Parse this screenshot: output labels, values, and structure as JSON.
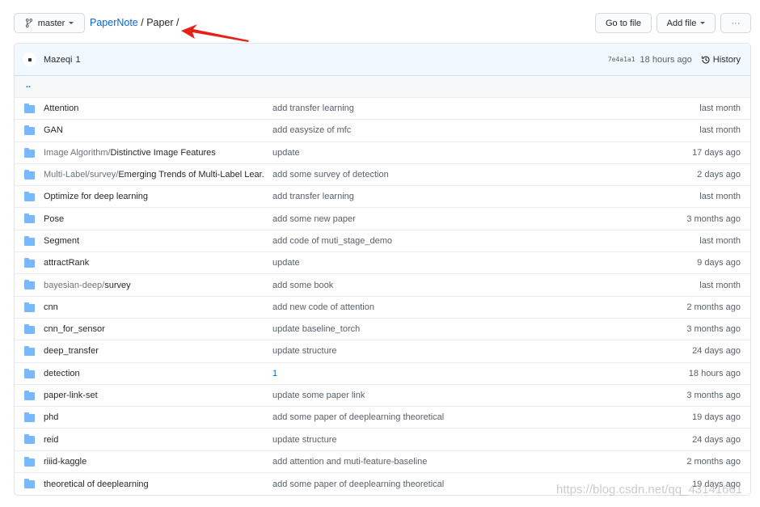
{
  "branch": {
    "label": "master",
    "icon": "git-branch-icon"
  },
  "breadcrumb": {
    "repo": "PaperNote",
    "sep1": " / ",
    "folder": "Paper",
    "sep2": " /"
  },
  "toolbar": {
    "go_to_file": "Go to file",
    "add_file": "Add file",
    "more": "···"
  },
  "commit": {
    "author": "Mazeqi",
    "message": "1",
    "sha": "7e4a1a1",
    "time": "18 hours ago",
    "history": "History"
  },
  "parent": "..",
  "files": [
    {
      "prefix": "",
      "name": "Attention",
      "message": "add transfer learning",
      "date": "last month"
    },
    {
      "prefix": "",
      "name": "GAN",
      "message": "add easysize of mfc",
      "date": "last month"
    },
    {
      "prefix": "Image Algorithm/",
      "name": "Distinctive Image Features",
      "message": "update",
      "date": "17 days ago"
    },
    {
      "prefix": "Multi-Label/survey/",
      "name": "Emerging Trends of Multi-Label Lear...",
      "message": "add some survey of detection",
      "date": "2 days ago"
    },
    {
      "prefix": "",
      "name": "Optimize for deep learning",
      "message": "add transfer learning",
      "date": "last month"
    },
    {
      "prefix": "",
      "name": "Pose",
      "message": "add some new paper",
      "date": "3 months ago"
    },
    {
      "prefix": "",
      "name": "Segment",
      "message": "add code of muti_stage_demo",
      "date": "last month"
    },
    {
      "prefix": "",
      "name": "attractRank",
      "message": "update",
      "date": "9 days ago"
    },
    {
      "prefix": "bayesian-deep/",
      "name": "survey",
      "message": "add some book",
      "date": "last month"
    },
    {
      "prefix": "",
      "name": "cnn",
      "message": "add new code of attention",
      "date": "2 months ago"
    },
    {
      "prefix": "",
      "name": "cnn_for_sensor",
      "message": "update baseline_torch",
      "date": "3 months ago"
    },
    {
      "prefix": "",
      "name": "deep_transfer",
      "message": "update structure",
      "date": "24 days ago"
    },
    {
      "prefix": "",
      "name": "detection",
      "message": "1",
      "date": "18 hours ago"
    },
    {
      "prefix": "",
      "name": "paper-link-set",
      "message": "update some paper link",
      "date": "3 months ago"
    },
    {
      "prefix": "",
      "name": "phd",
      "message": "add some paper of deeplearning theoretical",
      "date": "19 days ago"
    },
    {
      "prefix": "",
      "name": "reid",
      "message": "update structure",
      "date": "24 days ago"
    },
    {
      "prefix": "",
      "name": "riiid-kaggle",
      "message": "add attention and muti-feature-baseline",
      "date": "2 months ago"
    },
    {
      "prefix": "",
      "name": "theoretical of deeplearning",
      "message": "add some paper of deeplearning theoretical",
      "date": "19 days ago"
    }
  ],
  "watermark": "https://blog.csdn.net/qq_43141661",
  "colors": {
    "link": "#0366d6",
    "folder": "#79b8ff",
    "arrow": "#e8201a"
  }
}
